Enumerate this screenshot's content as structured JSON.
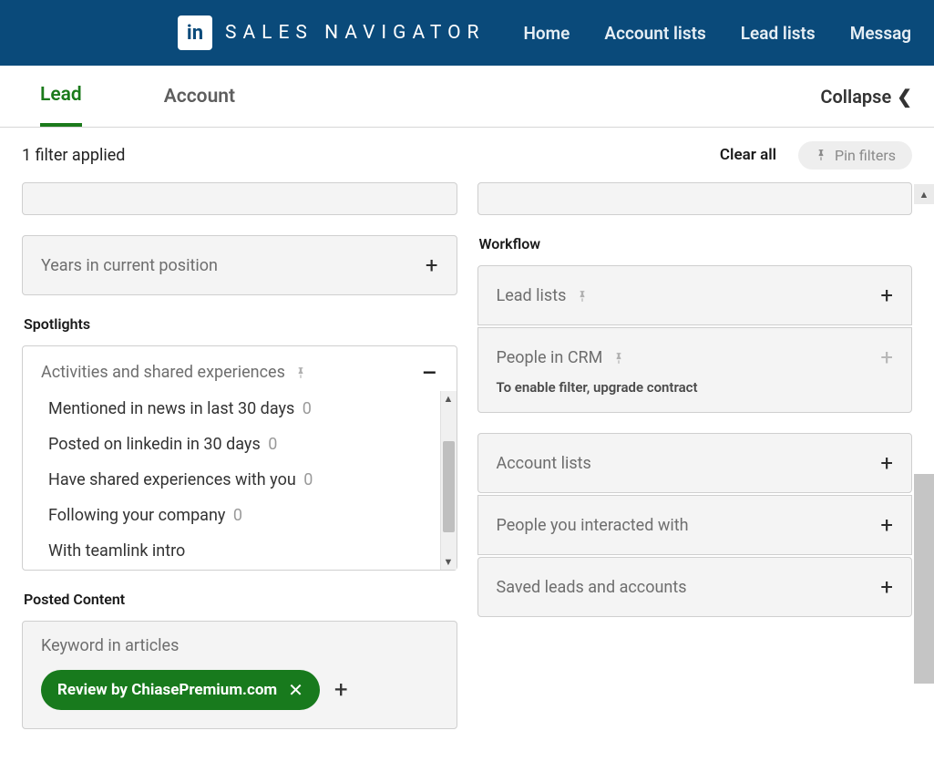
{
  "nav": {
    "app_title": "SALES NAVIGATOR",
    "links": [
      "Home",
      "Account lists",
      "Lead lists",
      "Messag"
    ]
  },
  "tabs": {
    "lead": "Lead",
    "account": "Account",
    "collapse": "Collapse"
  },
  "toolbar": {
    "filter_count": "1 filter applied",
    "clear_all": "Clear all",
    "pin_filters": "Pin filters"
  },
  "left": {
    "years_label": "Years in current position",
    "spotlights_heading": "Spotlights",
    "activities_label": "Activities and shared experiences",
    "options": [
      {
        "text": "Mentioned in news in last 30 days",
        "count": "0"
      },
      {
        "text": "Posted on linkedin in 30 days",
        "count": "0"
      },
      {
        "text": "Have shared experiences with you",
        "count": "0"
      },
      {
        "text": "Following your company",
        "count": "0"
      },
      {
        "text": "With teamlink intro",
        "count": ""
      }
    ],
    "posted_heading": "Posted Content",
    "keyword_label": "Keyword in articles",
    "chip_text": "Review by ChiasePremium.com"
  },
  "right": {
    "workflow_heading": "Workflow",
    "lead_lists": "Lead lists",
    "people_crm": "People in CRM",
    "crm_hint": "To enable filter, upgrade contract",
    "account_lists": "Account lists",
    "people_interacted": "People you interacted with",
    "saved_leads": "Saved leads and accounts"
  }
}
